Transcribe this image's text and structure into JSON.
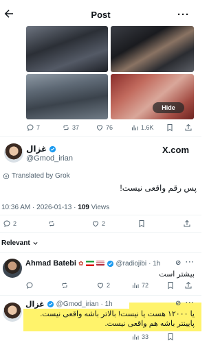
{
  "header": {
    "title": "Post"
  },
  "media": {
    "hide_label": "Hide"
  },
  "media_actions": {
    "replies": "7",
    "reposts": "37",
    "likes": "76",
    "views": "1.6K"
  },
  "tweet": {
    "name": "غزال",
    "handle": "@Gmod_irian",
    "source": "X.com",
    "translated": "Translated by Grok",
    "text": "پس رقم واقعی نیست!",
    "timestamp": "10:36 AM · 2026-01-13 ·",
    "views_count": "109",
    "views_label": "Views",
    "replies": "2",
    "likes": "2"
  },
  "relevant": {
    "label": "Relevant"
  },
  "replies": [
    {
      "name": "Ahmad Batebi",
      "handle": "@radiojibi",
      "time": "· 1h",
      "text": "بیشتر است",
      "replies": "",
      "likes": "2",
      "views": "72"
    },
    {
      "name": "غزال",
      "handle": "@Gmod_irian",
      "time": "· 1h",
      "text": "یا ۱۲۰۰۰ هست یا نیست! بالاتر باشه واقعی نیست. پایینتر باشه هم واقعی نیست.",
      "views": "33"
    }
  ],
  "colors": {
    "verified": "#1d9bf0",
    "highlight": "#fff36b",
    "muted": "#536471"
  }
}
